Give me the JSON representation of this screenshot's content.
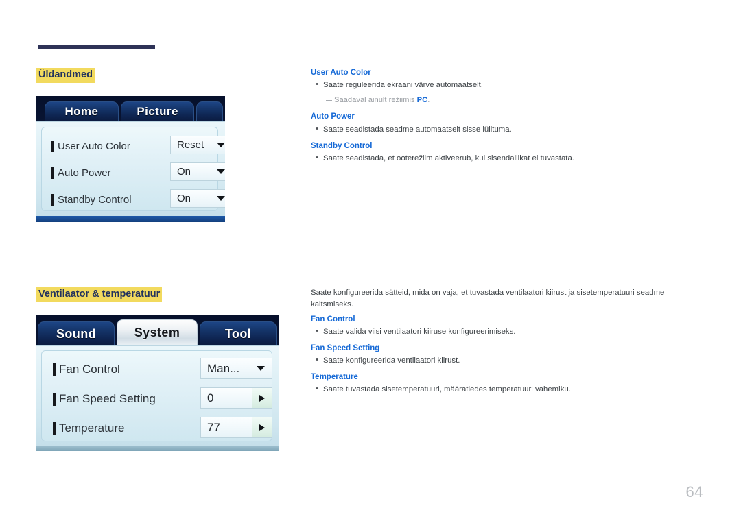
{
  "page": {
    "number": "64"
  },
  "sections": [
    {
      "heading": "Üldandmed",
      "osd": {
        "tabs": [
          {
            "label": "Home",
            "selected": false
          },
          {
            "label": "Picture",
            "selected": false
          }
        ],
        "rows": [
          {
            "label": "User Auto Color",
            "value": "Reset",
            "control": "dropdown"
          },
          {
            "label": "Auto Power",
            "value": "On",
            "control": "dropdown"
          },
          {
            "label": "Standby Control",
            "value": "On",
            "control": "dropdown"
          }
        ]
      },
      "text": {
        "items": [
          {
            "title": "User Auto Color",
            "bullets": [
              "Saate reguleerida ekraani värve automaatselt."
            ],
            "note_prefix": "Saadaval ainult režiimis ",
            "note_link": "PC",
            "note_suffix": "."
          },
          {
            "title": "Auto Power",
            "bullets": [
              "Saate seadistada seadme automaatselt sisse lülituma."
            ]
          },
          {
            "title": "Standby Control",
            "bullets": [
              "Saate seadistada, et ooterežiim aktiveerub, kui sisendallikat ei tuvastata."
            ]
          }
        ]
      }
    },
    {
      "heading": "Ventilaator & temperatuur",
      "osd": {
        "tabs": [
          {
            "label": "Sound",
            "selected": false
          },
          {
            "label": "System",
            "selected": true
          },
          {
            "label": "Tool",
            "selected": false
          }
        ],
        "rows": [
          {
            "label": "Fan Control",
            "value": "Man...",
            "control": "dropdown"
          },
          {
            "label": "Fan Speed Setting",
            "value": "0",
            "control": "stepper"
          },
          {
            "label": "Temperature",
            "value": "77",
            "control": "stepper"
          }
        ]
      },
      "text": {
        "intro": "Saate konfigureerida sätteid, mida on vaja, et tuvastada ventilaatori kiirust ja sisetemperatuuri seadme kaitsmiseks.",
        "items": [
          {
            "title": "Fan Control",
            "bullets": [
              "Saate valida viisi ventilaatori kiiruse konfigureerimiseks."
            ]
          },
          {
            "title": "Fan Speed Setting",
            "bullets": [
              "Saate konfigureerida ventilaatori kiirust."
            ]
          },
          {
            "title": "Temperature",
            "bullets": [
              "Saate tuvastada sisetemperatuuri, määratledes temperatuuri vahemiku."
            ]
          }
        ]
      }
    }
  ],
  "icons": {
    "dropdown": "chevron-down-icon",
    "stepper": "chevron-right-icon",
    "bullet": "•"
  },
  "colors": {
    "heading_highlight": "#f2da5e",
    "heading_text": "#22325e",
    "subhead_blue": "#1569d6",
    "rule_navy": "#2e3257",
    "page_number": "#b9bcc0"
  }
}
